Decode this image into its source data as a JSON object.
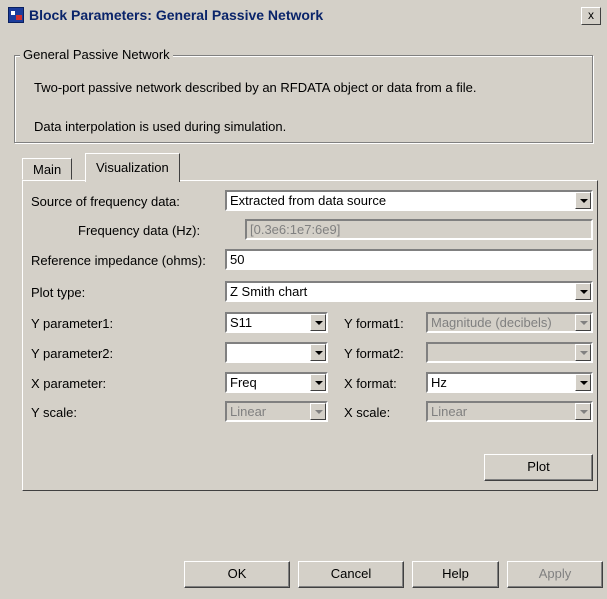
{
  "window": {
    "title": "Block Parameters: General Passive Network",
    "close_label": "x"
  },
  "group": {
    "legend": "General Passive Network",
    "desc1": "Two-port passive network described by an RFDATA object or data from a file.",
    "desc2": "Data interpolation is used during simulation."
  },
  "tabs": [
    {
      "label": "Main"
    },
    {
      "label": "Visualization"
    }
  ],
  "fields": {
    "source_label": "Source of frequency data:",
    "source_value": "Extracted from data source",
    "freq_label": "Frequency data (Hz):",
    "freq_value": "[0.3e6:1e7:6e9]",
    "ref_label": "Reference impedance (ohms):",
    "ref_value": "50",
    "plot_type_label": "Plot type:",
    "plot_type_value": "Z Smith chart",
    "y1_label": "Y parameter1:",
    "y1_value": "S11",
    "yf1_label": "Y format1:",
    "yf1_value": "Magnitude (decibels)",
    "y2_label": "Y parameter2:",
    "y2_value": "",
    "yf2_label": "Y format2:",
    "yf2_value": "",
    "x_label": "X parameter:",
    "x_value": "Freq",
    "xf_label": "X format:",
    "xf_value": "Hz",
    "ys_label": "Y scale:",
    "ys_value": "Linear",
    "xs_label": "X scale:",
    "xs_value": "Linear"
  },
  "buttons": {
    "plot": "Plot",
    "ok": "OK",
    "cancel": "Cancel",
    "help": "Help",
    "apply": "Apply"
  }
}
